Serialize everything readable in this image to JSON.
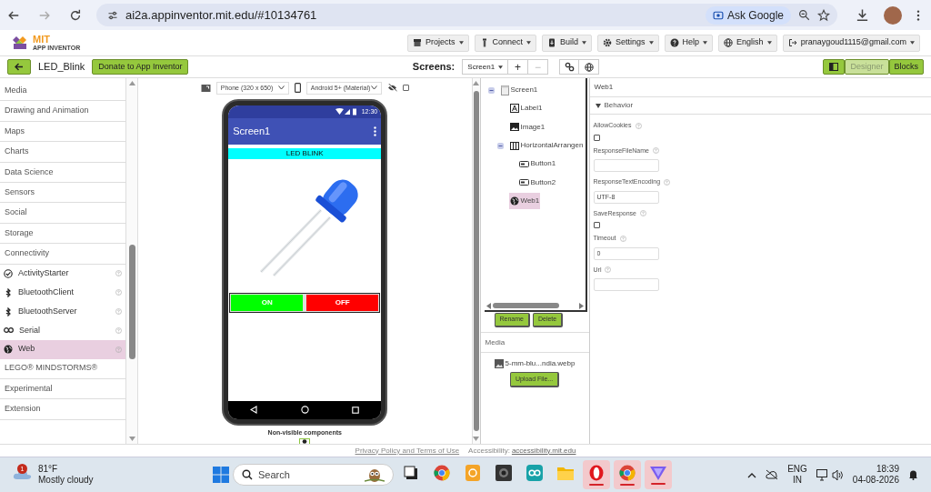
{
  "browser": {
    "url": "ai2a.appinventor.mit.edu/#10134761",
    "ask": "Ask Google"
  },
  "app_header": {
    "logo_title": "MIT",
    "logo_subtitle": "APP INVENTOR",
    "menus": [
      {
        "kind": "projects",
        "label": "Projects"
      },
      {
        "kind": "connect",
        "label": "Connect"
      },
      {
        "kind": "build",
        "label": "Build"
      },
      {
        "kind": "settings",
        "label": "Settings"
      },
      {
        "kind": "help",
        "label": "Help"
      },
      {
        "kind": "language",
        "label": "English"
      },
      {
        "kind": "account",
        "label": "pranaygoud1115@gmail.com"
      }
    ]
  },
  "toolbar": {
    "project": "LED_Blink",
    "donate": "Donate to App Inventor",
    "screens_label": "Screens:",
    "screen": "Screen1",
    "add": "+",
    "remove": "−",
    "modes": [
      {
        "label": "Designer",
        "selected": true
      },
      {
        "label": "Blocks",
        "selected": false
      }
    ]
  },
  "palette": {
    "categories": [
      {
        "label": "Media"
      },
      {
        "label": "Drawing and Animation"
      },
      {
        "label": "Maps"
      },
      {
        "label": "Charts"
      },
      {
        "label": "Data Science"
      },
      {
        "label": "Sensors"
      },
      {
        "label": "Social"
      },
      {
        "label": "Storage"
      },
      {
        "label": "Connectivity",
        "children": [
          {
            "label": "ActivityStarter",
            "kind": "check",
            "selected": false
          },
          {
            "label": "BluetoothClient",
            "kind": "bluetooth",
            "selected": false
          },
          {
            "label": "BluetoothServer",
            "kind": "bluetooth",
            "selected": false
          },
          {
            "label": "Serial",
            "kind": "serial",
            "selected": false
          },
          {
            "label": "Web",
            "kind": "globe",
            "selected": true
          }
        ]
      },
      {
        "label": "LEGO® MINDSTORMS®"
      },
      {
        "label": "Experimental"
      },
      {
        "label": "Extension"
      }
    ]
  },
  "viewer": {
    "device": "Phone (320 x 650)",
    "theme": "Android 5+ (Material)",
    "show_hidden": false,
    "phone": {
      "time": "12:30",
      "title": "Screen1",
      "label": "LED BLINK",
      "buttons": [
        {
          "label": "ON",
          "color": "#00ff00"
        },
        {
          "label": "OFF",
          "color": "#ff0000"
        }
      ]
    },
    "non_visible": "Non-visible components"
  },
  "components": {
    "tree": [
      {
        "label": "Screen1",
        "kind": "screen",
        "expanded": true,
        "selected": false,
        "children": [
          {
            "label": "Label1",
            "kind": "label",
            "selected": false
          },
          {
            "label": "Image1",
            "kind": "image",
            "selected": false
          },
          {
            "label": "HorizontalArrangen",
            "kind": "arrangement",
            "expanded": true,
            "selected": false,
            "children": [
              {
                "label": "Button1",
                "kind": "button",
                "selected": false
              },
              {
                "label": "Button2",
                "kind": "button",
                "selected": false
              }
            ]
          },
          {
            "label": "Web1",
            "kind": "web",
            "selected": true
          }
        ]
      }
    ],
    "rename": "Rename",
    "delete": "Delete"
  },
  "media": {
    "title": "Media",
    "files": [
      "5-mm-blu...ndia.webp"
    ],
    "upload": "Upload File..."
  },
  "properties": {
    "component": "Web1",
    "section": "Behavior",
    "expanded": true,
    "props": [
      {
        "label": "AllowCookies",
        "kind": "checkbox",
        "checked": false
      },
      {
        "label": "ResponseFileName",
        "kind": "text"
      },
      {
        "label": "ResponseTextEncoding",
        "kind": "text",
        "value": "UTF-8"
      },
      {
        "label": "SaveResponse",
        "kind": "checkbox",
        "checked": false
      },
      {
        "label": "Timeout",
        "kind": "text",
        "value": "0"
      },
      {
        "label": "Url",
        "kind": "text"
      }
    ]
  },
  "footer": {
    "privacy": "Privacy Policy and Terms of Use",
    "accessibility_label": "Accessibility:",
    "accessibility_link": "accessibility.mit.edu"
  },
  "taskbar": {
    "weather": {
      "badge": "1",
      "temp": "81°F",
      "condition": "Mostly cloudy"
    },
    "search": "Search",
    "apps": [
      {
        "kind": "squares",
        "running": false
      },
      {
        "kind": "browser",
        "running": false
      },
      {
        "kind": "note",
        "running": false
      },
      {
        "kind": "camera",
        "running": false
      },
      {
        "kind": "infinity",
        "running": false
      },
      {
        "kind": "folder",
        "running": false
      },
      {
        "kind": "ring",
        "running": true
      },
      {
        "kind": "browser",
        "running": true
      },
      {
        "kind": "triangle",
        "running": true
      }
    ],
    "lang": "ENG",
    "region": "IN",
    "time": "18:39",
    "date": "04-08-2026"
  }
}
